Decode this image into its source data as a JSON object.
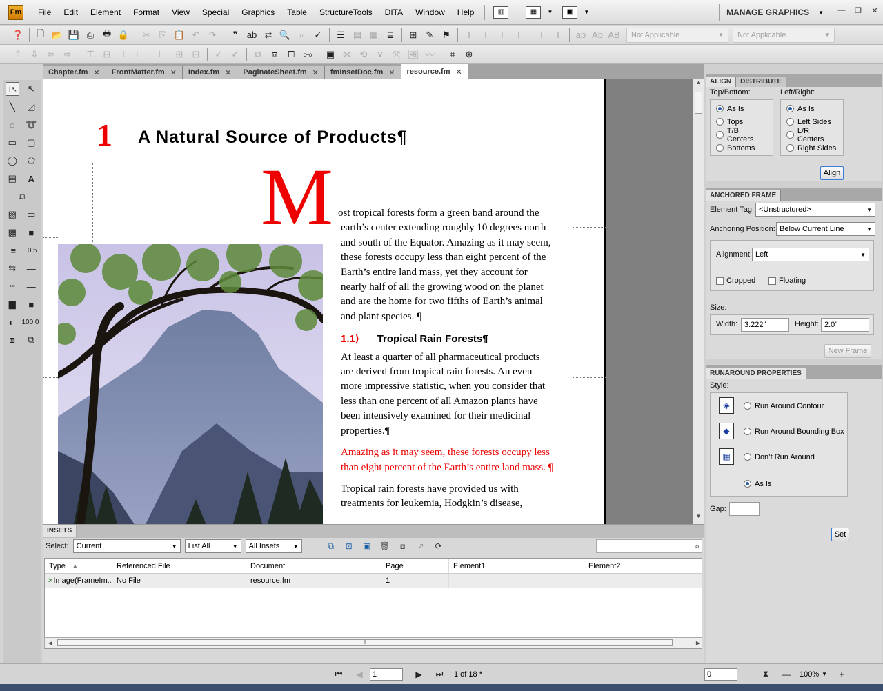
{
  "app": {
    "logo": "Fm",
    "workspace": "MANAGE GRAPHICS"
  },
  "menu": [
    "File",
    "Edit",
    "Element",
    "Format",
    "View",
    "Special",
    "Graphics",
    "Table",
    "StructureTools",
    "DITA",
    "Window",
    "Help"
  ],
  "toolbar": {
    "na_select_1": "Not Applicable",
    "na_select_2": "Not Applicable",
    "text_T": "T",
    "text_ab1": "ab",
    "text_Ab": "Ab",
    "text_AB": "AB"
  },
  "tools": {
    "line_weight": "0.5",
    "tint": "100.0"
  },
  "tabs": [
    "Chapter.fm",
    "FrontMatter.fm",
    "Index.fm",
    "PaginateSheet.fm",
    "fmInsetDoc.fm",
    "resource.fm"
  ],
  "tab_close": "✕",
  "document": {
    "chapter_number": "1",
    "chapter_title": "A Natural Source of Products¶",
    "dropcap": "M",
    "para1": "ost tropical forests form a green band around the earth’s center extending roughly 10 degrees north and south of the Equator. Amazing as it may seem, these forests occupy less than eight percent of the Earth’s entire land mass, yet they account for nearly half of all the growing wood on the planet and are the home for two fifths of Earth’s animal and plant species. ¶",
    "subhead_number": "1.1⟩",
    "subhead_title": "Tropical Rain Forests¶",
    "para2": "At least a quarter of all pharmaceutical products are derived from tropical rain forests. An even more impressive statistic, when you consider that less than one percent of all Amazon plants have been intensively examined for their medicinal properties.¶",
    "para3_red": "Amazing as it may seem, these forests occupy less than eight percent of the Earth’s entire land mass. ¶",
    "para4": "Tropical rain forests have provided us with treatments for leukemia, Hodgkin’s disease,"
  },
  "insets": {
    "panel_title": "INSETS",
    "select_label": "Select:",
    "select_current": "Current",
    "select_list": "List All",
    "select_insets": "All Insets",
    "columns": [
      "Type",
      "Referenced File",
      "Document",
      "Page",
      "Element1",
      "Element2"
    ],
    "rows": [
      {
        "type": "Image(FrameIm...",
        "ref": "No File",
        "doc": "resource.fm",
        "page": "1",
        "el1": "",
        "el2": ""
      }
    ]
  },
  "status": {
    "page_input": "1",
    "page_of": "1 of 18 *",
    "coord_input": "0",
    "zoom": "100%"
  },
  "align": {
    "tab_align": "ALIGN",
    "tab_distribute": "DISTRIBUTE",
    "topbottom_label": "Top/Bottom:",
    "leftright_label": "Left/Right:",
    "topbottom_opts": [
      "As Is",
      "Tops",
      "T/B Centers",
      "Bottoms"
    ],
    "leftright_opts": [
      "As Is",
      "Left Sides",
      "L/R Centers",
      "Right Sides"
    ],
    "button": "Align"
  },
  "anchored": {
    "title": "ANCHORED FRAME",
    "element_tag_label": "Element Tag:",
    "element_tag": "<Unstructured>",
    "anchoring_label": "Anchoring Position:",
    "anchoring": "Below Current Line",
    "alignment_label": "Alignment:",
    "alignment": "Left",
    "cropped": "Cropped",
    "floating": "Floating",
    "size_label": "Size:",
    "width_label": "Width:",
    "width": "3.222\"",
    "height_label": "Height:",
    "height": "2.0\"",
    "new_frame": "New Frame"
  },
  "runaround": {
    "title": "RUNAROUND PROPERTIES",
    "style_label": "Style:",
    "opts": [
      "Run Around Contour",
      "Run Around Bounding Box",
      "Don’t Run Around",
      "As Is"
    ],
    "gap_label": "Gap:",
    "set_button": "Set"
  }
}
